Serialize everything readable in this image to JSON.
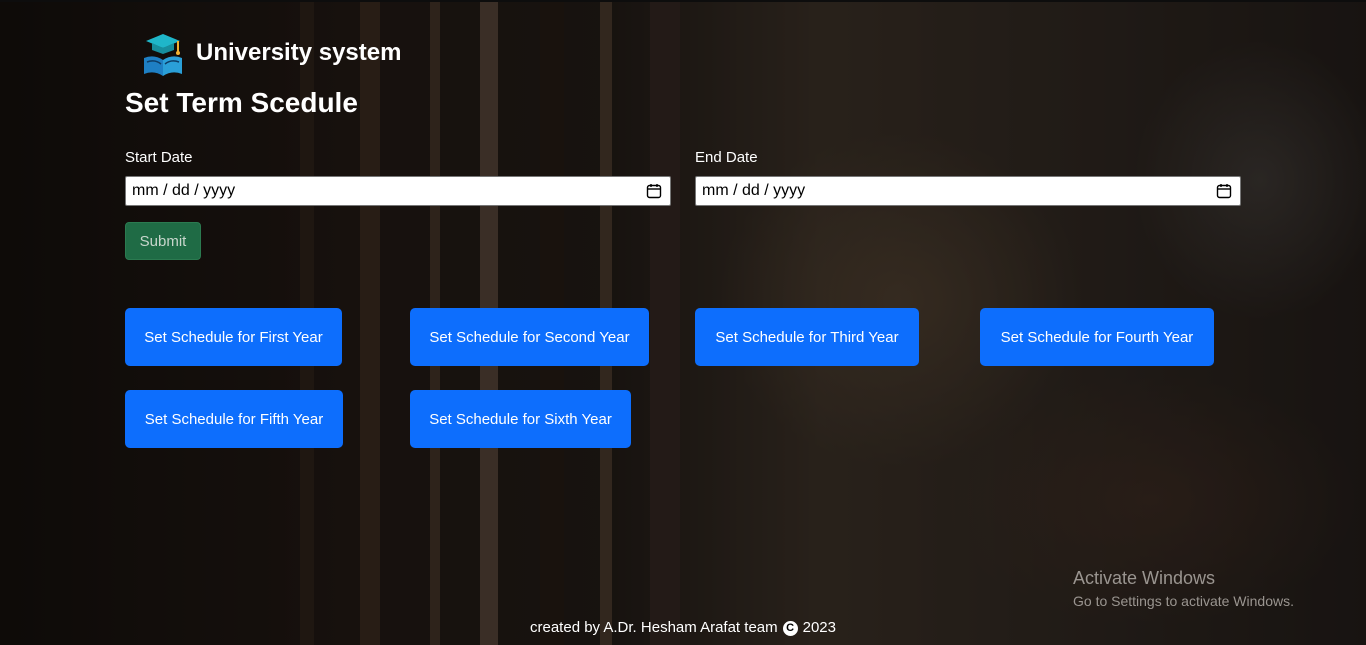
{
  "app": {
    "name": "University system"
  },
  "page": {
    "title": "Set Term Scedule"
  },
  "form": {
    "start_label": "Start Date",
    "start_value": "mm / dd / yyyy",
    "end_label": "End Date",
    "end_value": "mm / dd / yyyy",
    "submit_label": "Submit"
  },
  "year_buttons": [
    "Set Schedule for First Year",
    "Set Schedule for Second Year",
    "Set Schedule for Third Year",
    "Set Schedule for Fourth Year",
    "Set Schedule for Fifth Year",
    "Set Schedule for Sixth Year"
  ],
  "watermark": {
    "title": "Activate Windows",
    "subtitle": "Go to Settings to activate Windows."
  },
  "footer": {
    "prefix": "created by A.Dr. Hesham Arafat team",
    "symbol": "C",
    "year": "2023"
  },
  "colors": {
    "primary": "#0d6efd",
    "submit": "#1f6b45",
    "overlay": "rgba(0,0,0,0.45)"
  }
}
